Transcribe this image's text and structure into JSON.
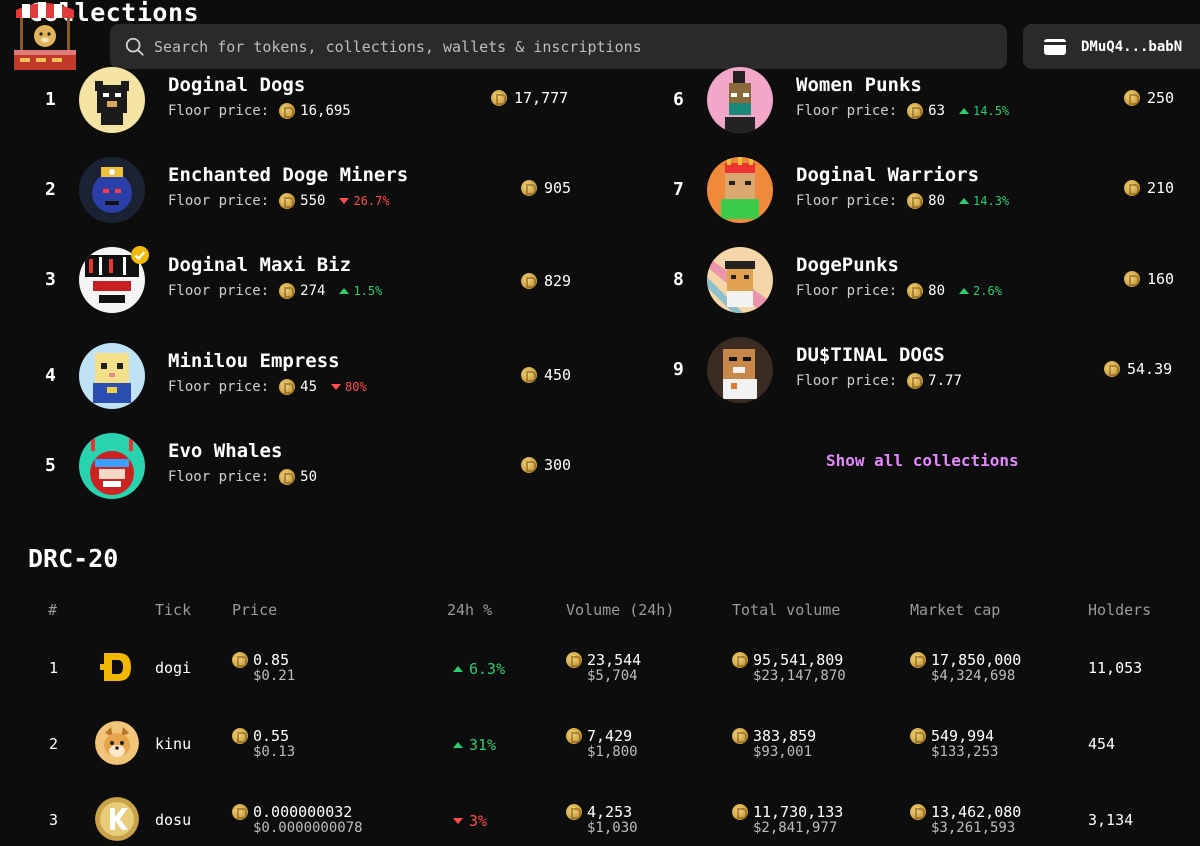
{
  "header": {
    "section_title": "Collections",
    "search_placeholder": "Search for tokens, collections, wallets & inscriptions",
    "wallet_label": "DMuQ4...babN"
  },
  "collections": [
    {
      "rank": "1",
      "name": "Doginal Dogs",
      "floor_label": "Floor price:",
      "floor": "16,695",
      "change": "",
      "change_dir": "",
      "volume": "17,777",
      "verified": false
    },
    {
      "rank": "2",
      "name": "Enchanted Doge Miners",
      "floor_label": "Floor price:",
      "floor": "550",
      "change": "26.7%",
      "change_dir": "down",
      "volume": "905",
      "verified": false
    },
    {
      "rank": "3",
      "name": "Doginal Maxi Biz",
      "floor_label": "Floor price:",
      "floor": "274",
      "change": "1.5%",
      "change_dir": "up",
      "volume": "829",
      "verified": true
    },
    {
      "rank": "4",
      "name": "Minilou Empress",
      "floor_label": "Floor price:",
      "floor": "45",
      "change": "80%",
      "change_dir": "down",
      "volume": "450",
      "verified": false
    },
    {
      "rank": "5",
      "name": "Evo Whales",
      "floor_label": "Floor price:",
      "floor": "50",
      "change": "",
      "change_dir": "",
      "volume": "300",
      "verified": false
    },
    {
      "rank": "6",
      "name": "Women Punks",
      "floor_label": "Floor price:",
      "floor": "63",
      "change": "14.5%",
      "change_dir": "up",
      "volume": "250",
      "verified": false
    },
    {
      "rank": "7",
      "name": "Doginal Warriors",
      "floor_label": "Floor price:",
      "floor": "80",
      "change": "14.3%",
      "change_dir": "up",
      "volume": "210",
      "verified": false
    },
    {
      "rank": "8",
      "name": "DogePunks",
      "floor_label": "Floor price:",
      "floor": "80",
      "change": "2.6%",
      "change_dir": "up",
      "volume": "160",
      "verified": false
    },
    {
      "rank": "9",
      "name": "DU$TINAL DOGS",
      "floor_label": "Floor price:",
      "floor": "7.77",
      "change": "",
      "change_dir": "",
      "volume": "54.39",
      "verified": false
    }
  ],
  "show_all_label": "Show all collections",
  "drc20": {
    "title": "DRC-20",
    "columns": [
      "#",
      "Tick",
      "Price",
      "24h %",
      "Volume (24h)",
      "Total volume",
      "Market cap",
      "Holders"
    ],
    "rows": [
      {
        "rank": "1",
        "tick": "dogi",
        "price": "0.85",
        "price_usd": "$0.21",
        "change": "6.3%",
        "change_dir": "up",
        "vol24": "23,544",
        "vol24_usd": "$5,704",
        "total": "95,541,809",
        "total_usd": "$23,147,870",
        "mcap": "17,850,000",
        "mcap_usd": "$4,324,698",
        "holders": "11,053"
      },
      {
        "rank": "2",
        "tick": "kinu",
        "price": "0.55",
        "price_usd": "$0.13",
        "change": "31%",
        "change_dir": "up",
        "vol24": "7,429",
        "vol24_usd": "$1,800",
        "total": "383,859",
        "total_usd": "$93,001",
        "mcap": "549,994",
        "mcap_usd": "$133,253",
        "holders": "454"
      },
      {
        "rank": "3",
        "tick": "dosu",
        "price": "0.000000032",
        "price_usd": "$0.0000000078",
        "change": "3%",
        "change_dir": "down",
        "vol24": "4,253",
        "vol24_usd": "$1,030",
        "total": "11,730,133",
        "total_usd": "$2,841,977",
        "mcap": "13,462,080",
        "mcap_usd": "$3,261,593",
        "holders": "3,134"
      }
    ]
  },
  "colors": {
    "accent_link": "#e589ff",
    "up": "#2ecc71",
    "down": "#ff4d4d",
    "bg": "#0d0d0d",
    "surface": "#2a2a2a"
  }
}
